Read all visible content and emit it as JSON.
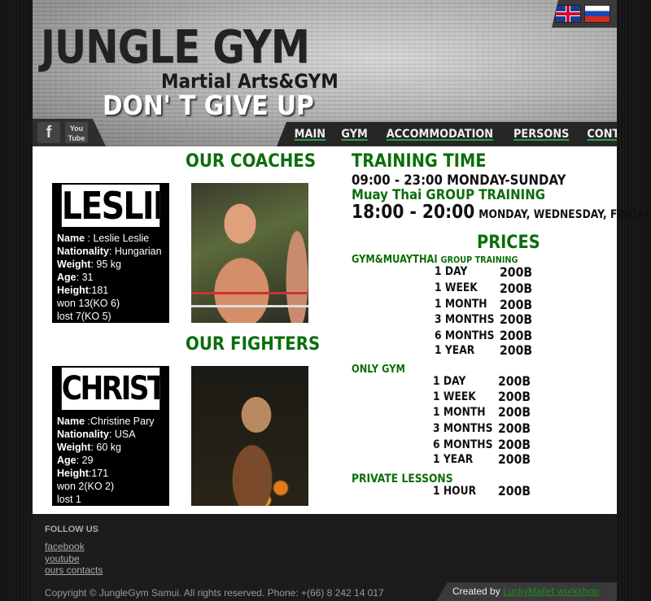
{
  "header": {
    "logo_title": "JUNGLE GYM",
    "logo_subtitle": "Martial Arts&GYM",
    "slogan": "DON' T GIVE UP",
    "languages": [
      {
        "name": "English",
        "icon": "uk-flag-icon"
      },
      {
        "name": "Russian",
        "icon": "ru-flag-icon"
      }
    ],
    "social": [
      {
        "label": "f",
        "icon": "facebook-icon"
      },
      {
        "label": "You Tube",
        "icon": "youtube-icon"
      }
    ]
  },
  "nav": {
    "items": [
      "MAIN",
      "GYM",
      "ACCOMMODATION",
      "PERSONS",
      "CONTACTS"
    ],
    "active": "GYM",
    "accent_color": "#2ea043"
  },
  "coaches": {
    "title": "OUR COACHES",
    "person": {
      "name_big": "LESLIE",
      "name_label": "Name",
      "name_value": " : Leslie Leslie",
      "nationality_label": "Nationality",
      "nationality_value": ": Hungarian",
      "weight_label": "Weight",
      "weight_value": ": 95 kg",
      "age_label": "Age",
      "age_value": ": 31",
      "height_label": "Height",
      "height_value": ":181",
      "won": "won 13(KO 6)",
      "lost": "lost 7(KO 5)"
    }
  },
  "fighters": {
    "title": "OUR FIGHTERS",
    "person": {
      "name_big": "CHRISTINE",
      "name_label": "Name",
      "name_value": " :Christine Pary",
      "nationality_label": "Nationality",
      "nationality_value": ": USA",
      "weight_label": "Weight",
      "weight_value": ": 60 kg",
      "age_label": "Age",
      "age_value": ": 29",
      "height_label": "Height",
      "height_value": ":171",
      "won": "won 2(KO 2)",
      "lost": "lost 1"
    }
  },
  "training": {
    "title": "TRAINING TIME",
    "hours": "09:00 - 23:00 MONDAY-SUNDAY",
    "group_title": "Muay Thai GROUP TRAINING",
    "group_time": "18:00 - 20:00",
    "group_days": "MONDAY, WEDNESDAY, FRIDAY"
  },
  "prices": {
    "title": "PRICES",
    "gym_muaythai": {
      "title": "GYM&MUAYTHAI",
      "subtitle": "GROUP TRAINING",
      "rows": [
        {
          "period": "1 DAY",
          "price": "200B"
        },
        {
          "period": "1 WEEK",
          "price": "200B"
        },
        {
          "period": "1 MONTH",
          "price": "200B"
        },
        {
          "period": "3 MONTHS",
          "price": "200B"
        },
        {
          "period": "6 MONTHS",
          "price": "200B"
        },
        {
          "period": "1 YEAR",
          "price": "200B"
        }
      ]
    },
    "only_gym": {
      "title": "ONLY GYM",
      "rows": [
        {
          "period": "1 DAY",
          "price": "200B"
        },
        {
          "period": "1 WEEK",
          "price": "200B"
        },
        {
          "period": "1 MONTH",
          "price": "200B"
        },
        {
          "period": "3 MONTHS",
          "price": "200B"
        },
        {
          "period": "6 MONTHS",
          "price": "200B"
        },
        {
          "period": "1 YEAR",
          "price": "200B"
        }
      ]
    },
    "private": {
      "title": "PRIVATE LESSONS",
      "rows": [
        {
          "period": "1 HOUR",
          "price": "200B"
        }
      ]
    }
  },
  "footer": {
    "follow_title": "FOLLOW US",
    "links": [
      "facebook",
      "youtube",
      "ours contacts"
    ],
    "copyright": "Copyright © JungleGym Samui.  All rights reserved. Phone: +(66) 8 242 14 017",
    "created_by": "Created by",
    "creator": "LuckyMallet workshop"
  }
}
